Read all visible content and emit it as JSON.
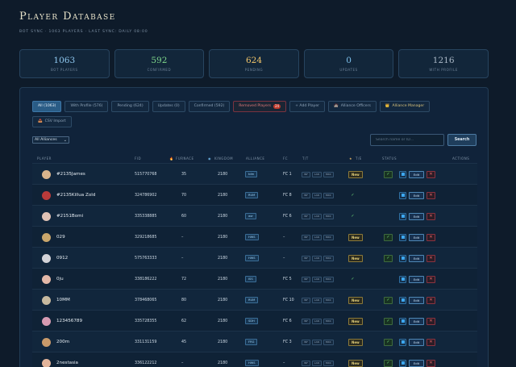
{
  "header": {
    "title": "Player Database",
    "subtitle": "BOT SYNC · 1063 PLAYERS · LAST SYNC: DAILY 08:00"
  },
  "stats": [
    {
      "value": "1063",
      "label": "BOT PLAYERS",
      "color": "#8fc8f0"
    },
    {
      "value": "592",
      "label": "CONFIRMED",
      "color": "#7ed68a"
    },
    {
      "value": "624",
      "label": "PENDING",
      "color": "#f0c46a"
    },
    {
      "value": "0",
      "label": "UPDATES",
      "color": "#7fc3ef"
    },
    {
      "value": "1216",
      "label": "WITH PROFILE",
      "color": "#a9b7c6"
    }
  ],
  "tabs": [
    {
      "label": "All (1063)",
      "style": "active"
    },
    {
      "label": "With Profile (576)",
      "style": ""
    },
    {
      "label": "Pending (624)",
      "style": ""
    },
    {
      "label": "Updates (0)",
      "style": ""
    },
    {
      "label": "Confirmed (592)",
      "style": ""
    },
    {
      "label": "Removed Players",
      "style": "red",
      "badge": "24"
    },
    {
      "label": "+ Add Player",
      "style": ""
    },
    {
      "label": "Alliance Officers",
      "style": "",
      "icon": "🏰"
    },
    {
      "label": "Alliance Manager",
      "style": "gold",
      "icon": "👑"
    },
    {
      "label": "CSV Import",
      "style": "",
      "icon": "📥"
    }
  ],
  "filter": {
    "alliance": "All Alliances"
  },
  "search": {
    "placeholder": "Search name or ID...",
    "button": "Search"
  },
  "columns": {
    "player": "PLAYER",
    "fid": "FID",
    "furnace": "FURNACE",
    "kingdom": "KINGDOM",
    "alliance": "ALLIANCE",
    "fc": "FC",
    "tt": "T/T",
    "tie": "T/E",
    "status": "STATUS",
    "actions": "ACTIONS"
  },
  "tt_buttons": [
    "INF",
    "LAN",
    "MRK"
  ],
  "actions": {
    "edit": "Edit",
    "delete": "✕",
    "confirm": "✓"
  },
  "players": [
    {
      "name": "#2135James",
      "fid": "515770768",
      "furnace": "35",
      "kingdom": "2180",
      "alliance": "tdm",
      "fc": "FC 1",
      "tag": "New",
      "status": "check",
      "avatar": "#d9b48c"
    },
    {
      "name": "#2135Killua Zold",
      "fid": "324786902",
      "furnace": "70",
      "kingdom": "2180",
      "alliance": "RUM",
      "fc": "FC 8",
      "tag": "check",
      "status": "",
      "avatar": "#b83a3a"
    },
    {
      "name": "#2151Bomi",
      "fid": "335338885",
      "furnace": "60",
      "kingdom": "2180",
      "alliance": "aor",
      "fc": "FC 6",
      "tag": "check",
      "status": "",
      "avatar": "#e0c2b5"
    },
    {
      "name": "029",
      "fid": "329218685",
      "furnace": "–",
      "kingdom": "2180",
      "alliance": "HWS",
      "fc": "–",
      "tag": "New",
      "status": "check",
      "avatar": "#c9a66b"
    },
    {
      "name": "0912",
      "fid": "575763333",
      "furnace": "–",
      "kingdom": "2180",
      "alliance": "HWS",
      "fc": "–",
      "tag": "New",
      "status": "check",
      "avatar": "#d3d3d8"
    },
    {
      "name": "0ju",
      "fid": "338186222",
      "furnace": "72",
      "kingdom": "2180",
      "alliance": "ISS",
      "fc": "FC 5",
      "tag": "check",
      "status": "",
      "avatar": "#e3b8a8"
    },
    {
      "name": "10MM",
      "fid": "378468065",
      "furnace": "80",
      "kingdom": "2180",
      "alliance": "RUM",
      "fc": "FC 10",
      "tag": "New",
      "status": "check",
      "avatar": "#c7b99f"
    },
    {
      "name": "123456789",
      "fid": "335728355",
      "furnace": "62",
      "kingdom": "2180",
      "alliance": "SDH",
      "fc": "FC 6",
      "tag": "New",
      "status": "check",
      "avatar": "#d79bb2"
    },
    {
      "name": "200m",
      "fid": "331131159",
      "furnace": "45",
      "kingdom": "2180",
      "alliance": "FRG",
      "fc": "FC 3",
      "tag": "New",
      "status": "check",
      "avatar": "#c99a6a"
    },
    {
      "name": "2nestasia",
      "fid": "336122212",
      "furnace": "–",
      "kingdom": "2180",
      "alliance": "HWS",
      "fc": "–",
      "tag": "New",
      "status": "check",
      "avatar": "#e2b49b"
    }
  ]
}
